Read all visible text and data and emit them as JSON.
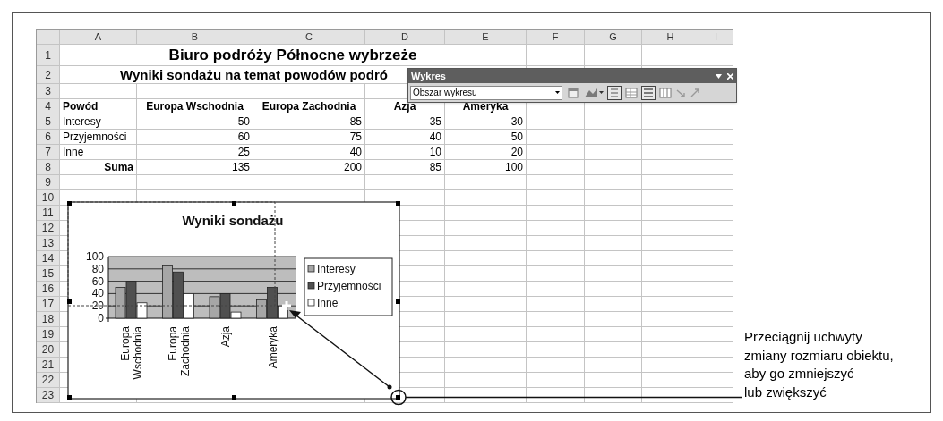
{
  "spreadsheet": {
    "column_headers": [
      "A",
      "B",
      "C",
      "D",
      "E",
      "F",
      "G",
      "H",
      "I"
    ],
    "row_headers": [
      "1",
      "2",
      "3",
      "4",
      "5",
      "6",
      "7",
      "8",
      "9",
      "10",
      "11",
      "12",
      "13",
      "14",
      "15",
      "16",
      "17",
      "18",
      "19",
      "20",
      "21",
      "22",
      "23"
    ],
    "title": "Biuro podróży Północne wybrzeże",
    "subtitle": "Wyniki sondażu na temat powodów podró",
    "header": [
      "Powód",
      "Europa Wschodnia",
      "Europa Zachodnia",
      "Azja",
      "Ameryka"
    ],
    "rows": [
      {
        "label": "Interesy",
        "values": [
          "50",
          "85",
          "35",
          "30"
        ]
      },
      {
        "label": "Przyjemności",
        "values": [
          "60",
          "75",
          "40",
          "50"
        ]
      },
      {
        "label": "Inne",
        "values": [
          "25",
          "40",
          "10",
          "20"
        ]
      }
    ],
    "total": {
      "label": "Suma",
      "values": [
        "135",
        "200",
        "85",
        "100"
      ]
    }
  },
  "chart_toolbar": {
    "title": "Wykres",
    "dropdown": "Obszar wykresu"
  },
  "chart": {
    "chart_data": {
      "type": "bar",
      "title": "Wyniki sondażu",
      "categories": [
        "Europa Wschodnia",
        "Europa Zachodnia",
        "Azja",
        "Ameryka"
      ],
      "series": [
        {
          "name": "Interesy",
          "color": "#a6a6a6",
          "values": [
            50,
            85,
            35,
            30
          ]
        },
        {
          "name": "Przyjemności",
          "color": "#505050",
          "values": [
            60,
            75,
            40,
            50
          ]
        },
        {
          "name": "Inne",
          "color": "#ffffff",
          "values": [
            25,
            40,
            10,
            20
          ]
        }
      ],
      "ylim": [
        0,
        100
      ],
      "yticks": [
        0,
        20,
        40,
        60,
        80,
        100
      ],
      "grid": true,
      "legend": "right"
    }
  },
  "callout": {
    "lines": [
      "Przeciągnij uchwyty",
      "zmiany rozmiaru obiektu,",
      "aby go zmniejszyć",
      "lub zwiększyć"
    ]
  }
}
